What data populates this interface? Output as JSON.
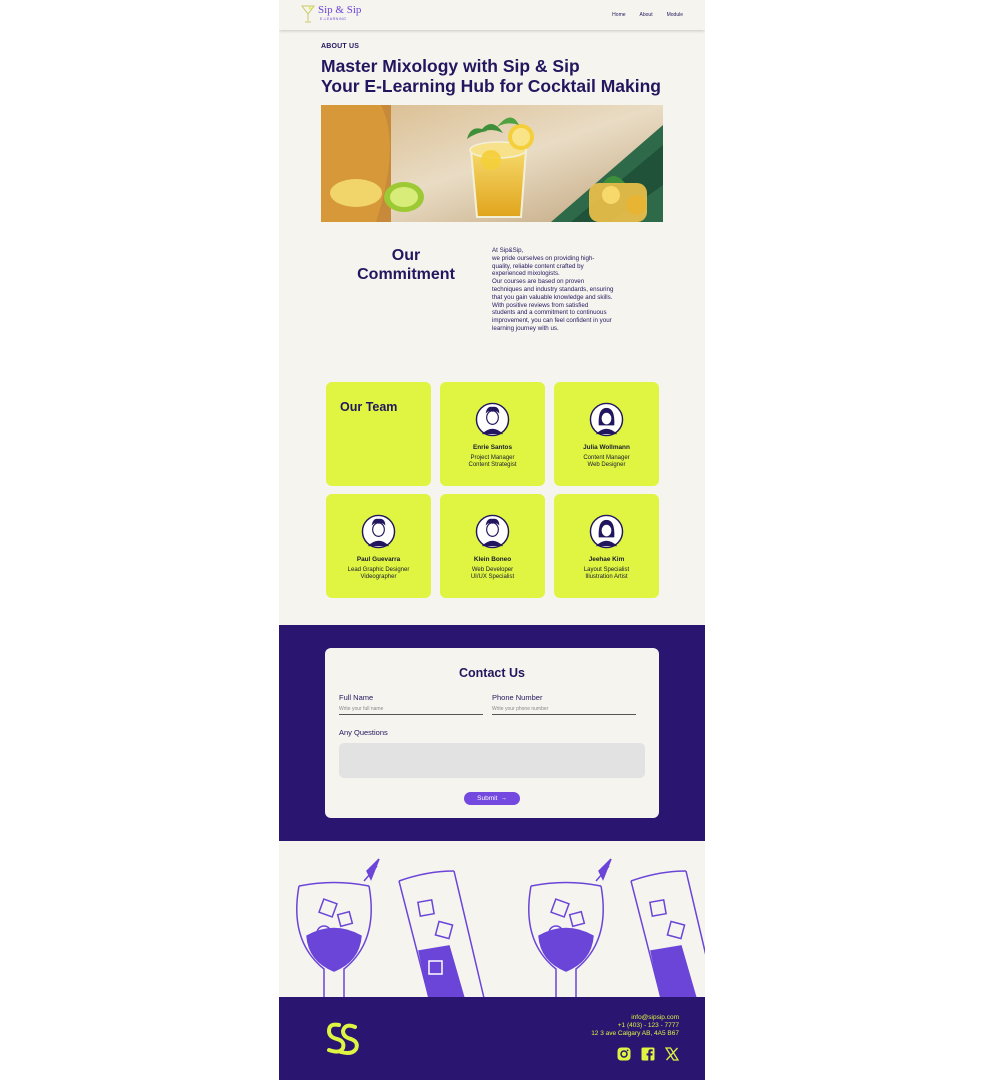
{
  "brand": {
    "name": "Sip & Sip",
    "tagline": "E-LEARNING"
  },
  "nav": {
    "items": [
      "Home",
      "About",
      "Module"
    ]
  },
  "about": {
    "tag": "ABOUT US",
    "headline_1": "Master Mixology with Sip & Sip",
    "headline_2": "Your E-Learning Hub for Cocktail Making"
  },
  "commitment": {
    "title_1": "Our",
    "title_2": "Commitment",
    "lines": [
      "At Sip&Sip,",
      "we pride ourselves on providing high-",
      "quality, reliable content crafted by",
      "experienced mixologists.",
      "Our courses are based on proven",
      "techniques and industry standards, ensuring",
      "that you gain valuable knowledge and skills.",
      "With positive reviews from satisfied",
      "students and a commitment to continuous",
      "improvement, you can feel confident in your",
      "learning journey with us."
    ]
  },
  "team": {
    "title": "Our Team",
    "members": [
      {
        "name": "Enrie Santos",
        "role_1": "Project Manager",
        "role_2": "Content Strategist",
        "avatar": "male-avatar-icon"
      },
      {
        "name": "Julia Wollmann",
        "role_1": "Content Manager",
        "role_2": "Web Designer",
        "avatar": "female-avatar-icon"
      },
      {
        "name": "Paul Guevarra",
        "role_1": "Lead Graphic Designer",
        "role_2": "Videographer",
        "avatar": "male-avatar-icon"
      },
      {
        "name": "Klein Boneo",
        "role_1": "Web Developer",
        "role_2": "UI/UX Specialist",
        "avatar": "male-avatar-icon"
      },
      {
        "name": "Jeehae Kim",
        "role_1": "Layout Specialist",
        "role_2": "Illustration Artist",
        "avatar": "female-avatar-icon"
      }
    ]
  },
  "contact": {
    "title": "Contact Us",
    "full_name_label": "Full Name",
    "full_name_placeholder": "Write your full name",
    "phone_label": "Phone Number",
    "phone_placeholder": "Write your phone number",
    "questions_label": "Any Questions",
    "submit_label": "Submit",
    "submit_icon": "arrow-right-icon"
  },
  "footer": {
    "email": "info@sipsip.com",
    "phone": "+1 (403) - 123 - 7777",
    "address": "12 3 ave Calgary AB, 4A5 B67",
    "social": [
      "instagram-icon",
      "facebook-icon",
      "x-icon"
    ]
  },
  "colors": {
    "primary": "#22175e",
    "band": "#2a1570",
    "accent_lime": "#dff542",
    "accent_purple": "#7349e0",
    "background": "#f6f4ef"
  }
}
